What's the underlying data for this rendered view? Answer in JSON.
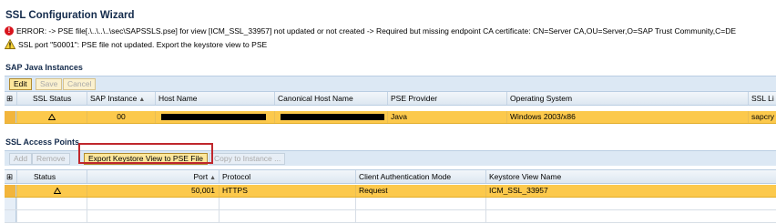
{
  "title": "SSL Configuration Wizard",
  "messages": {
    "error_icon": "error-icon",
    "error_text": "ERROR:  -> PSE file[.\\..\\..\\..\\sec\\SAPSSLS.pse] for view [ICM_SSL_33957] not updated or not created -> Required but missing endpoint CA certificate: CN=Server CA,OU=Server,O=SAP Trust Community,C=DE",
    "warning_icon": "warning-icon",
    "warning_text": "SSL port \"50001\": PSE file not updated. Export the keystore view to PSE"
  },
  "java_instances": {
    "title": "SAP Java Instances",
    "buttons": {
      "edit": "Edit",
      "save": "Save",
      "cancel": "Cancel"
    },
    "columns": [
      "SSL Status",
      "SAP Instance",
      "Host Name",
      "Canonical Host Name",
      "PSE Provider",
      "Operating System",
      "SSL Li"
    ],
    "sort_indicator": "▲",
    "rows": [
      {
        "status_icon": "warning-icon",
        "instance": "00",
        "host": "",
        "canonical": "",
        "provider": "Java",
        "os": "Windows 2003/x86",
        "ssl": "sapcry"
      }
    ]
  },
  "access_points": {
    "title": "SSL Access Points",
    "buttons": {
      "add": "Add",
      "remove": "Remove",
      "export": "Export Keystore View to PSE File",
      "copy": "Copy to Instance ..."
    },
    "columns": [
      "Status",
      "Port",
      "Protocol",
      "Client Authentication Mode",
      "Keystore View Name"
    ],
    "sort_indicator": "▲",
    "rows": [
      {
        "status_icon": "warning-icon",
        "port": "50,001",
        "protocol": "HTTPS",
        "auth": "Request",
        "view": "ICM_SSL_33957"
      }
    ]
  },
  "colors": {
    "selected_row": "#fcc94c",
    "highlight_box": "#c0272d",
    "error": "#d8141d"
  }
}
